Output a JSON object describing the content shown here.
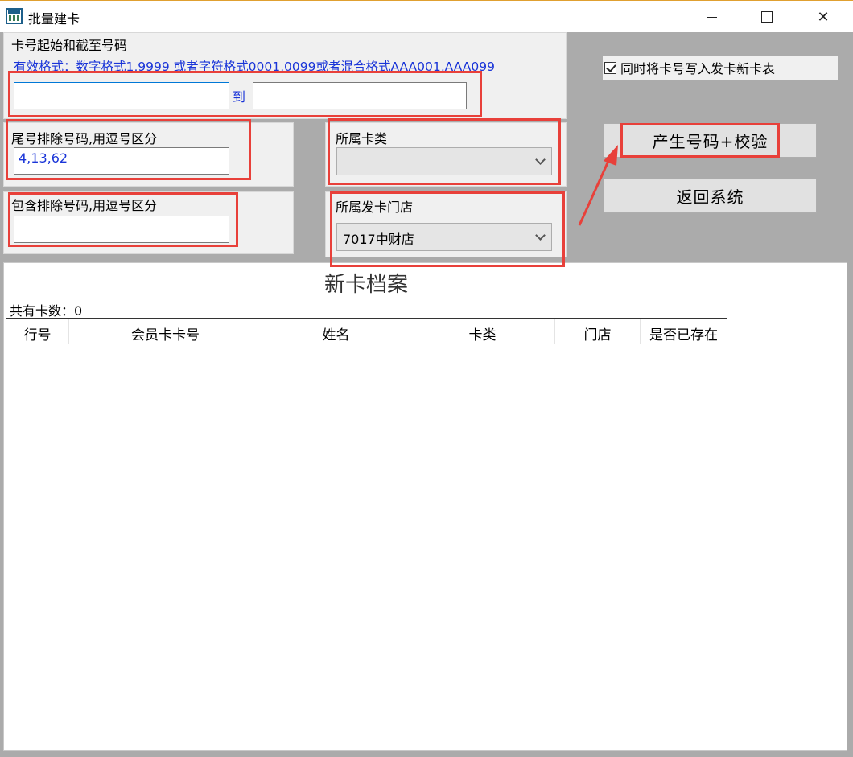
{
  "window": {
    "title": "批量建卡",
    "close_symbol": "✕"
  },
  "card_range": {
    "group_label": "卡号起始和截至号码",
    "hint": "有效格式：数字格式1,9999 或者字符格式0001,0099或者混合格式AAA001,AAA099",
    "from_value": "",
    "to_label": "到",
    "to_value": ""
  },
  "tail_exclude": {
    "label": "尾号排除号码,用逗号区分",
    "value": "4,13,62"
  },
  "contain_exclude": {
    "label": "包含排除号码,用逗号区分",
    "value": ""
  },
  "card_type": {
    "label": "所属卡类",
    "selected": ""
  },
  "store": {
    "label": "所属发卡门店",
    "selected": "7017中财店"
  },
  "options": {
    "write_new_card_table": "同时将卡号写入发卡新卡表",
    "checked": true
  },
  "actions": {
    "generate": "产生号码+校验",
    "back": "返回系统"
  },
  "archive": {
    "title": "新卡档案",
    "count_label": "共有卡数：",
    "count": "0",
    "columns": [
      "行号",
      "会员卡卡号",
      "姓名",
      "卡类",
      "门店",
      "是否已存在"
    ],
    "rows": []
  },
  "colors": {
    "annotation": "#e8403a",
    "hint_text": "#1a35d8"
  }
}
